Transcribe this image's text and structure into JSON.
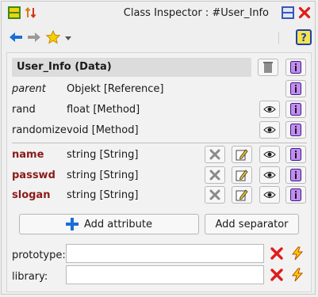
{
  "window": {
    "title": "Class Inspector : #User_Info"
  },
  "toolbar": {
    "icons": [
      "layout-icon",
      "sort-icon",
      "back-arrow-icon",
      "forward-arrow-icon",
      "star-icon",
      "dropdown-icon",
      "help-icon"
    ],
    "help_label": "?"
  },
  "header": {
    "label": "User_Info (Data)"
  },
  "rows": [
    {
      "label": "parent",
      "type": "Objekt [Reference]"
    },
    {
      "label": "rand",
      "type": "float [Method]"
    },
    {
      "label": "randomize",
      "type": "void [Method]"
    }
  ],
  "attributes": [
    {
      "label": "name",
      "type": "string [String]"
    },
    {
      "label": "passwd",
      "type": "string [String]"
    },
    {
      "label": "slogan",
      "type": "string [String]"
    }
  ],
  "buttons": {
    "add_attribute": "Add attribute",
    "add_separator": "Add separator"
  },
  "fields": {
    "prototype_label": "prototype:",
    "prototype_value": "",
    "library_label": "library:",
    "library_value": ""
  },
  "colors": {
    "accent_blue": "#1b6fd1",
    "delete_red": "#e01b1b",
    "attr_label": "#8b1a1a",
    "info_purple": "#7a2fbf"
  }
}
